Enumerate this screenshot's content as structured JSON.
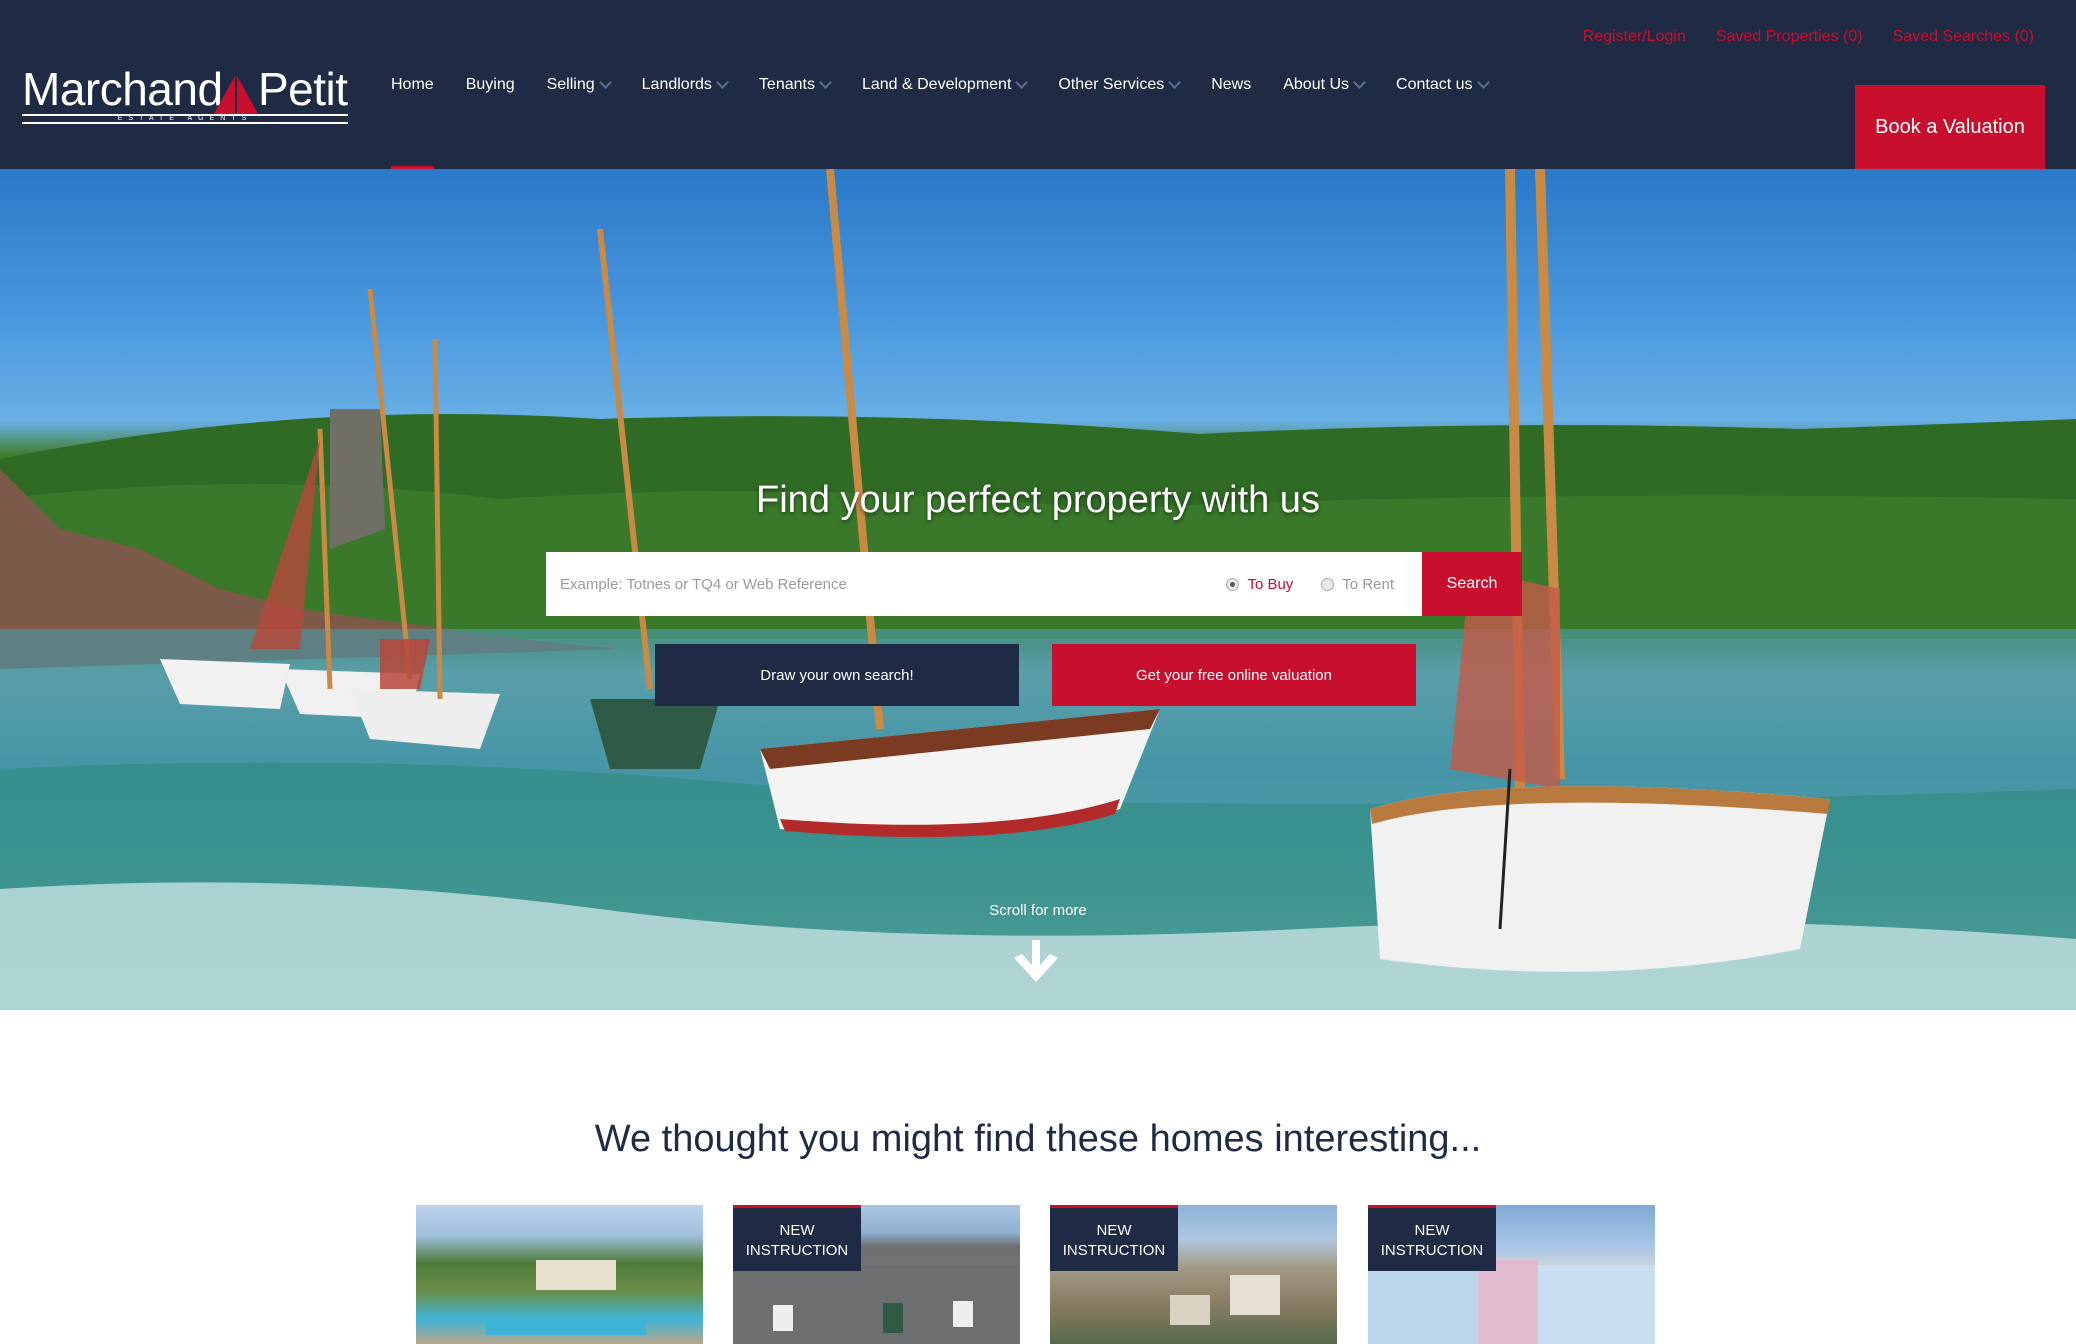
{
  "toplinks": {
    "register": "Register/Login",
    "saved_properties": "Saved Properties (0)",
    "saved_searches": "Saved Searches (0)"
  },
  "logo": {
    "left_word": "Marchand",
    "right_word": "Petit",
    "tagline": "ESTATE AGENTS"
  },
  "nav": {
    "items": [
      {
        "label": "Home",
        "active": true
      },
      {
        "label": "Buying"
      },
      {
        "label": "Selling",
        "dropdown": true
      },
      {
        "label": "Landlords",
        "dropdown": true
      },
      {
        "label": "Tenants",
        "dropdown": true
      },
      {
        "label": "Land & Development",
        "dropdown": true
      },
      {
        "label": "Other Services",
        "dropdown": true
      },
      {
        "label": "News"
      },
      {
        "label": "About Us",
        "dropdown": true
      },
      {
        "label": "Contact us",
        "dropdown": true
      }
    ],
    "book_valuation": "Book a Valuation"
  },
  "hero": {
    "title": "Find your perfect property with us",
    "search": {
      "placeholder": "Example: Totnes or TQ4 or Web Reference",
      "value": "",
      "to_buy": "To Buy",
      "to_rent": "To Rent",
      "selected": "To Buy",
      "button": "Search"
    },
    "draw_search": "Draw your own search!",
    "free_valuation": "Get your free online valuation",
    "scroll_label": "Scroll for more"
  },
  "featured": {
    "title": "We thought you might find these homes interesting...",
    "cards": [
      {
        "badge": ""
      },
      {
        "badge_line1": "NEW",
        "badge_line2": "INSTRUCTION"
      },
      {
        "badge_line1": "NEW",
        "badge_line2": "INSTRUCTION"
      },
      {
        "badge_line1": "NEW",
        "badge_line2": "INSTRUCTION"
      }
    ]
  },
  "colors": {
    "navy": "#1f2a44",
    "red": "#c8102e",
    "white": "#ffffff"
  }
}
